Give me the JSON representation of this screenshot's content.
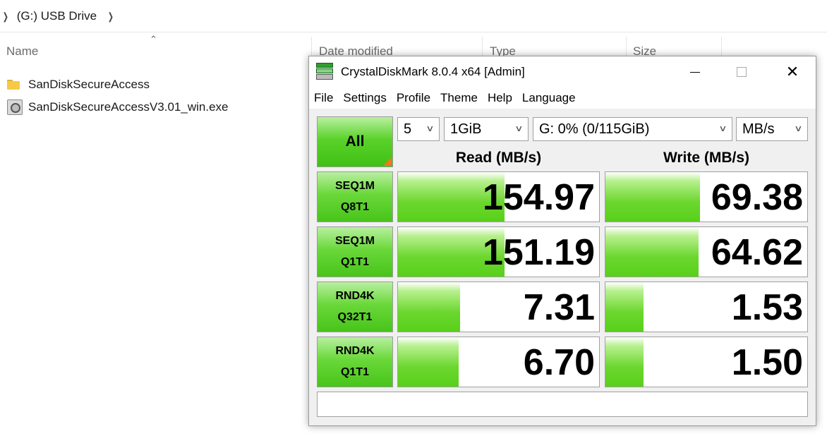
{
  "explorer": {
    "breadcrumb": "(G:) USB Drive",
    "columns": {
      "name": "Name",
      "date_modified": "Date modified",
      "type": "Type",
      "size": "Size"
    },
    "files": [
      {
        "name": "SanDiskSecureAccess",
        "icon": "folder-icon"
      },
      {
        "name": "SanDiskSecureAccessV3.01_win.exe",
        "icon": "exe-icon"
      }
    ]
  },
  "cdm": {
    "title": "CrystalDiskMark 8.0.4 x64 [Admin]",
    "menu": [
      "File",
      "Settings",
      "Profile",
      "Theme",
      "Help",
      "Language"
    ],
    "all_label": "All",
    "settings": {
      "count": "5",
      "size": "1GiB",
      "drive": "G: 0% (0/115GiB)",
      "unit": "MB/s"
    },
    "read_header": "Read (MB/s)",
    "write_header": "Write (MB/s)",
    "tests": [
      {
        "line1": "SEQ1M",
        "line2": "Q8T1",
        "read": "154.97",
        "write": "69.38",
        "read_fill": 0.53,
        "write_fill": 0.47
      },
      {
        "line1": "SEQ1M",
        "line2": "Q1T1",
        "read": "151.19",
        "write": "64.62",
        "read_fill": 0.53,
        "write_fill": 0.46
      },
      {
        "line1": "RND4K",
        "line2": "Q32T1",
        "read": "7.31",
        "write": "1.53",
        "read_fill": 0.31,
        "write_fill": 0.19
      },
      {
        "line1": "RND4K",
        "line2": "Q1T1",
        "read": "6.70",
        "write": "1.50",
        "read_fill": 0.3,
        "write_fill": 0.19
      }
    ],
    "comment": ""
  }
}
